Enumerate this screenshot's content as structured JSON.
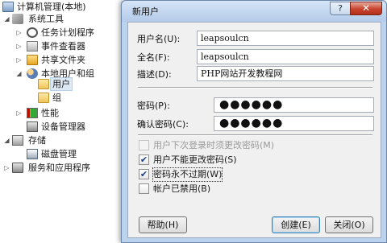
{
  "tree": {
    "root": "计算机管理(本地)",
    "system_tools": "系统工具",
    "task_scheduler": "任务计划程序",
    "event_viewer": "事件查看器",
    "shared_folders": "共享文件夹",
    "local_users_groups": "本地用户和组",
    "users": "用户",
    "groups": "组",
    "performance": "性能",
    "device_manager": "设备管理器",
    "storage": "存储",
    "disk_management": "磁盘管理",
    "services_apps": "服务和应用程序"
  },
  "dialog": {
    "title": "新用户",
    "help_icon": "?",
    "close_icon": "✕",
    "username_label": "用户名(U):",
    "username_value": "leapsoulcn",
    "fullname_label": "全名(F):",
    "fullname_value": "leapsoulcn",
    "description_label": "描述(D):",
    "description_value": "PHP网站开发教程网",
    "password_label": "密码(P):",
    "password_value": "●●●●●●",
    "confirm_label": "确认密码(C):",
    "confirm_value": "●●●●●●",
    "checkboxes": [
      {
        "label": "用户下次登录时须更改密码(M)",
        "checked": "",
        "state": "disabled"
      },
      {
        "label": "用户不能更改密码(S)",
        "checked": "✔",
        "state": "checked"
      },
      {
        "label": "密码永不过期(W)",
        "checked": "✔",
        "state": "checked"
      },
      {
        "label": "帐户已禁用(B)",
        "checked": "",
        "state": "unchecked"
      }
    ],
    "help_button": "帮助(H)",
    "create_button": "创建(E)",
    "close_button": "关闭(O)"
  }
}
